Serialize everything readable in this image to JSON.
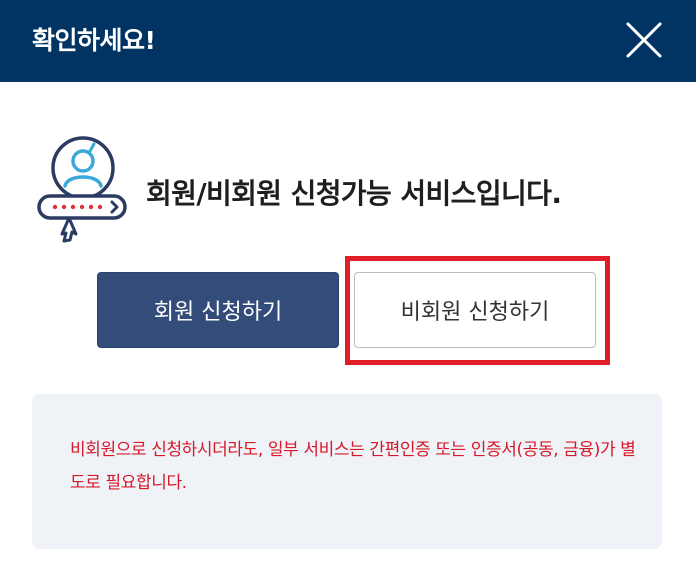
{
  "dialog": {
    "title": "확인하세요!",
    "close_icon": "close-icon"
  },
  "notice": {
    "icon": "member-login-icon",
    "message": "회원/비회원 신청가능 서비스입니다."
  },
  "buttons": {
    "member_label": "회원 신청하기",
    "nonmember_label": "비회원 신청하기"
  },
  "info": {
    "text": "비회원으로 신청하시더라도, 일부 서비스는 간편인증 또는 인증서(공동, 금융)가 별도로 필요합니다."
  },
  "colors": {
    "header_bg": "#013462",
    "primary_button": "#344c7a",
    "highlight": "#e01e2a",
    "info_text": "#d7182a",
    "info_bg": "#eff3f7"
  }
}
